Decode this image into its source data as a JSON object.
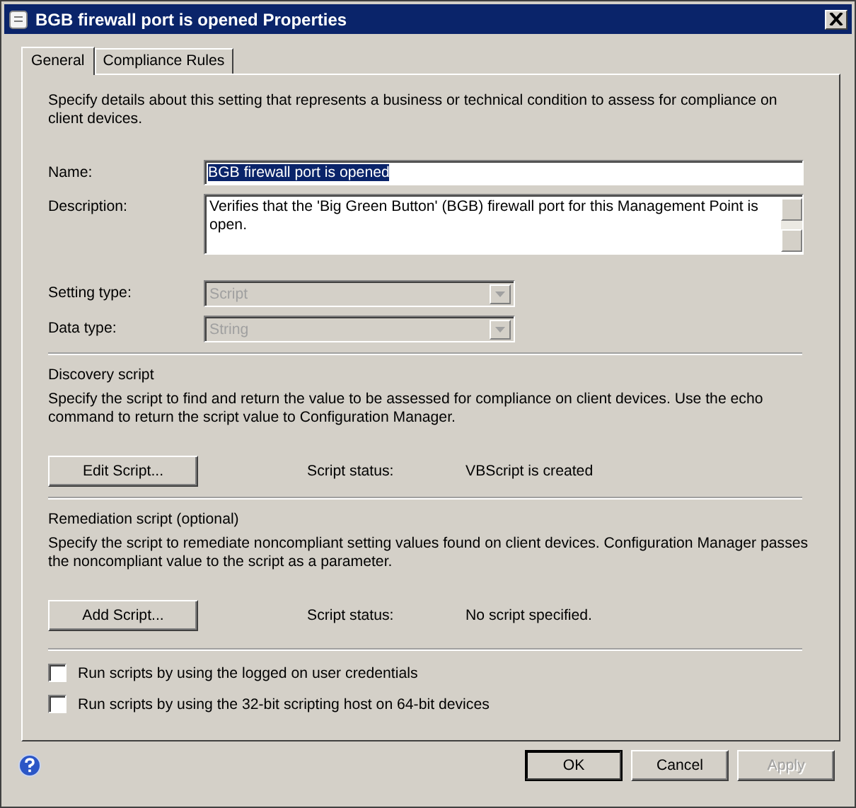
{
  "window": {
    "title": "BGB firewall port is opened Properties"
  },
  "tabs": [
    {
      "label": "General",
      "selected": true
    },
    {
      "label": "Compliance Rules",
      "selected": false
    }
  ],
  "intro": "Specify details about this setting that represents a business or technical condition to assess for compliance on client devices.",
  "name_field": {
    "label": "Name:",
    "value": "BGB firewall port is opened",
    "highlighted": true
  },
  "description_field": {
    "label": "Description:",
    "value": "Verifies that the 'Big Green Button' (BGB) firewall port for this Management Point is open."
  },
  "dropdowns": [
    {
      "label": "Setting type:",
      "value": "Script",
      "disabled": true
    },
    {
      "label": "Data type:",
      "value": "String",
      "disabled": true
    }
  ],
  "sections": [
    {
      "heading": "Discovery script",
      "description": "Specify the script to find and return the value to be assessed for compliance on client devices. Use the echo command to return the script value to Configuration Manager.",
      "button": "Edit Script...",
      "status_label": "Script status:",
      "status": "VBScript is created"
    },
    {
      "heading": "Remediation script (optional)",
      "description": "Specify the script to remediate noncompliant setting values found on client devices. Configuration Manager passes the noncompliant value to the script as a parameter.",
      "button": "Add Script...",
      "status_label": "Script status:",
      "status": "No script specified."
    }
  ],
  "checkboxes": [
    {
      "label": "Run scripts by using the logged on user credentials",
      "checked": false
    },
    {
      "label": "Run scripts by using the 32-bit scripting host on 64-bit devices",
      "checked": false
    }
  ],
  "buttons": [
    {
      "label": "OK",
      "default": true,
      "disabled": false
    },
    {
      "label": "Cancel",
      "default": false,
      "disabled": false
    },
    {
      "label": "Apply",
      "default": false,
      "disabled": true
    }
  ]
}
